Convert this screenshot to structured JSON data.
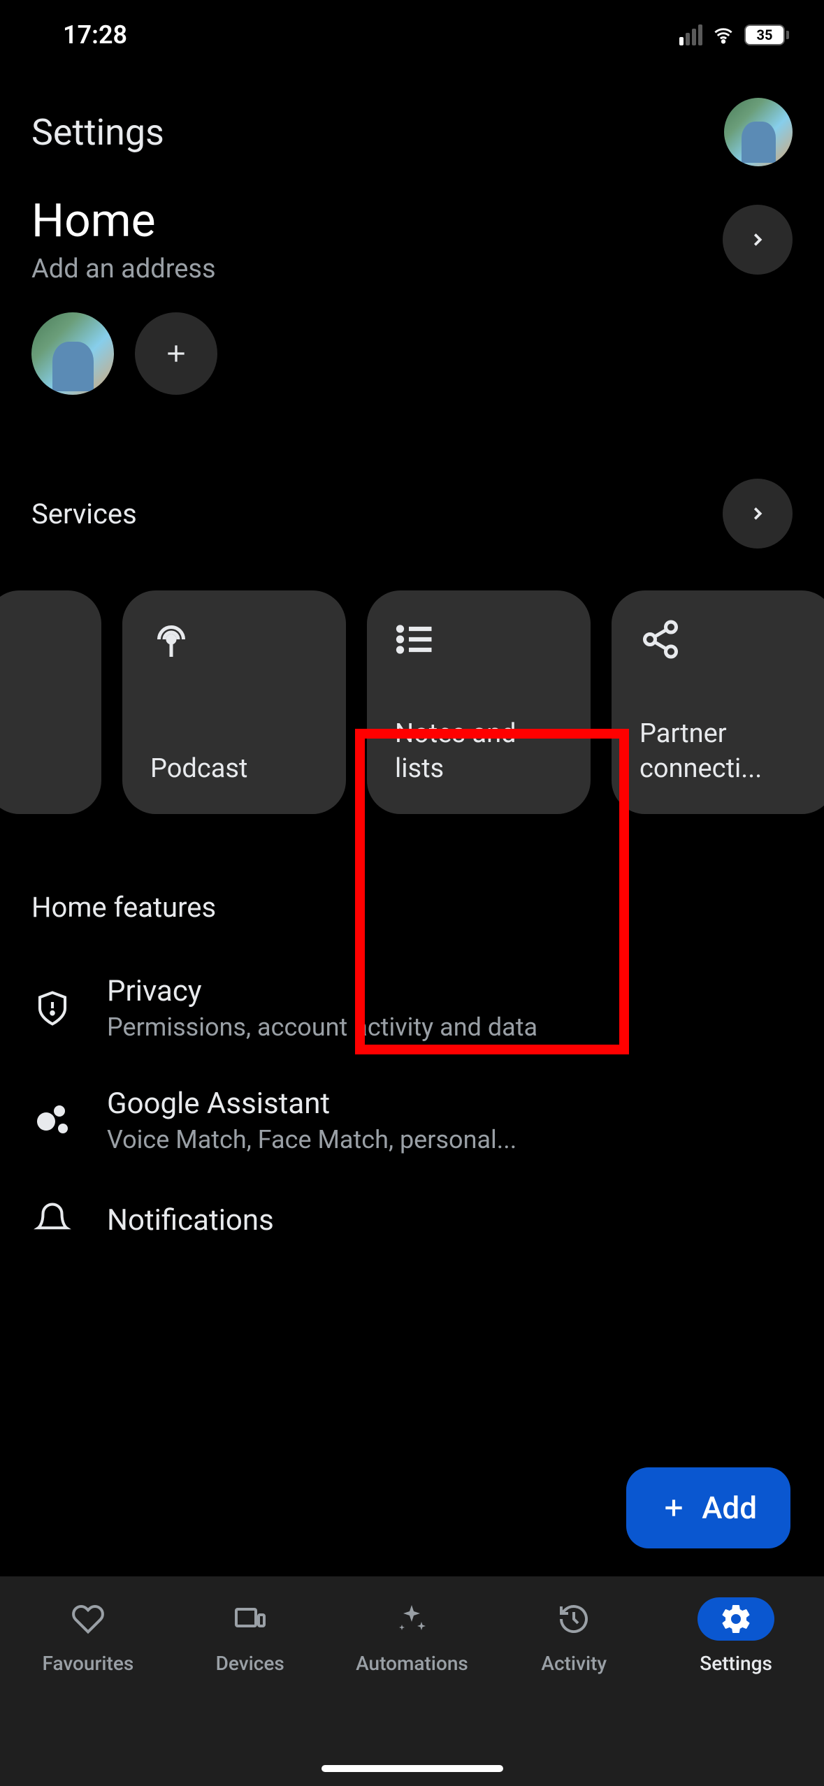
{
  "status_bar": {
    "time": "17:28",
    "battery": "35"
  },
  "header": {
    "title": "Settings"
  },
  "home": {
    "title": "Home",
    "subtitle": "Add an address"
  },
  "services": {
    "title": "Services",
    "cards": [
      {
        "label": ""
      },
      {
        "label": "Podcast"
      },
      {
        "label": "Notes and lists"
      },
      {
        "label": "Partner connecti..."
      }
    ]
  },
  "features": {
    "title": "Home features",
    "items": [
      {
        "title": "Privacy",
        "subtitle": "Permissions, account activity and data"
      },
      {
        "title": "Google Assistant",
        "subtitle": "Voice Match, Face Match, personal..."
      },
      {
        "title": "Notifications",
        "subtitle": ""
      }
    ]
  },
  "fab": {
    "label": "Add"
  },
  "nav": {
    "items": [
      {
        "label": "Favourites"
      },
      {
        "label": "Devices"
      },
      {
        "label": "Automations"
      },
      {
        "label": "Activity"
      },
      {
        "label": "Settings"
      }
    ]
  }
}
